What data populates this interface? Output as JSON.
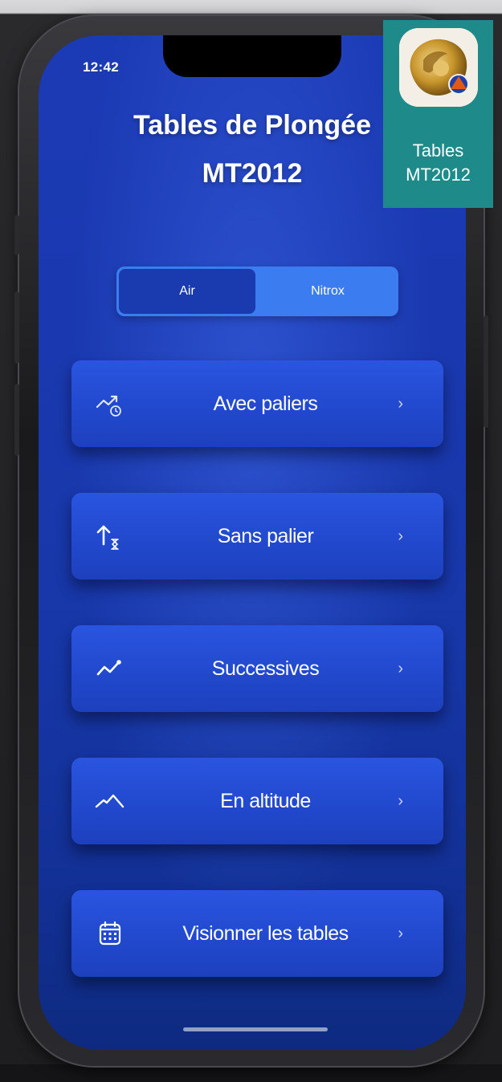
{
  "status_bar": {
    "time": "12:42"
  },
  "app": {
    "title_line1": "Tables de Plongée",
    "title_line2": "MT2012"
  },
  "gas_selector": {
    "options": [
      "Air",
      "Nitrox"
    ],
    "selected": "Air"
  },
  "menu": [
    {
      "label": "Avec paliers",
      "icon": "chart-clock-icon"
    },
    {
      "label": "Sans palier",
      "icon": "ascent-hourglass-icon"
    },
    {
      "label": "Successives",
      "icon": "trend-line-icon"
    },
    {
      "label": "En altitude",
      "icon": "mountain-icon"
    },
    {
      "label": "Visionner les tables",
      "icon": "calendar-icon"
    }
  ],
  "chevron": "›",
  "app_icon_overlay": {
    "label_line1": "Tables",
    "label_line2": "MT2012"
  },
  "colors": {
    "background_blue": "#1a39b0",
    "button_blue": "#2148cc",
    "segment_active": "#1a3ab0",
    "segment_track": "#3b7cf0",
    "overlay_teal": "#1f8a8a"
  }
}
